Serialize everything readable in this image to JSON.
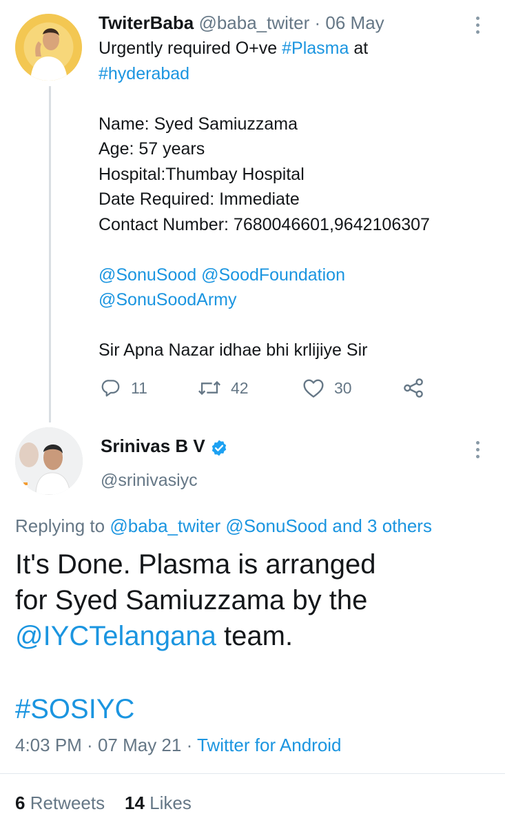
{
  "tweet1": {
    "display_name": "TwiterBaba",
    "handle": "@baba_twiter",
    "separator": "·",
    "date": "06 May",
    "text_intro": "Urgently required O+ve ",
    "hashtag_plasma": "#Plasma",
    "text_at": " at",
    "hashtag_city": "#hyderabad",
    "details": [
      "Name: Syed Samiuzzama",
      "Age: 57 years",
      "Hospital:Thumbay Hospital",
      "Date Required: Immediate",
      "Contact Number: 7680046601,9642106307"
    ],
    "mention_1": "@SonuSood",
    "mention_2": "@SoodFoundation",
    "mention_3": "@SonuSoodArmy",
    "closing": "Sir Apna Nazar idhae bhi krlijiye Sir",
    "actions": {
      "reply_count": "11",
      "retweet_count": "42",
      "like_count": "30"
    }
  },
  "tweet2": {
    "display_name": "Srinivas B V",
    "handle": "@srinivasiyc",
    "replying_label": "Replying to ",
    "replying_mentions": "@baba_twiter @SonuSood",
    "replying_and": " and ",
    "replying_others": "3 others",
    "body_line1": "It's Done. Plasma is arranged",
    "body_line2": "for Syed Samiuzzama by the",
    "body_mention": "@IYCTelangana",
    "body_end": " team.",
    "hashtag": "#SOSIYC",
    "time": "4:03 PM",
    "meta_sep": " · ",
    "date": "07 May 21",
    "source": "Twitter for Android",
    "retweets_count": "6",
    "retweets_label": "Retweets",
    "likes_count": "14",
    "likes_label": "Likes"
  },
  "colors": {
    "link": "#1b95e0",
    "secondary_text": "#657786",
    "verified": "#1da1f2",
    "thread_line": "#d9dee3"
  },
  "icons": [
    "reply-icon",
    "retweet-icon",
    "like-icon",
    "share-icon",
    "more-options-icon",
    "verified-badge-icon"
  ]
}
